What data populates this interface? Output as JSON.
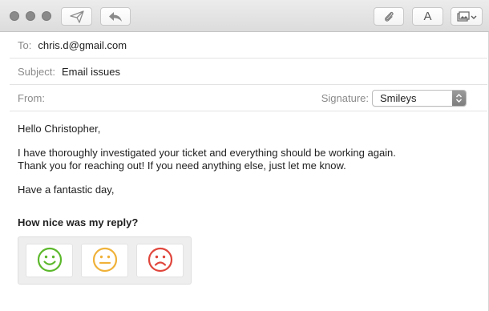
{
  "compose": {
    "to_label": "To:",
    "to_value": "chris.d@gmail.com",
    "subject_label": "Subject:",
    "subject_value": "Email issues",
    "from_label": "From:",
    "signature_label": "Signature:",
    "signature_value": "Smileys"
  },
  "toolbar": {
    "icons": [
      "send-icon",
      "reply-icon",
      "attachment-icon",
      "format-font-icon",
      "photo-browser-icon"
    ],
    "font_glyph": "A"
  },
  "message": {
    "greeting": "Hello Christopher,",
    "line1": "I have thoroughly investigated your ticket and everything should be working again.",
    "line2": "Thank you for reaching out! If you need anything else, just let me know.",
    "closing": "Have a fantastic day,",
    "question": "How nice was my reply?"
  },
  "rating": {
    "options": [
      {
        "name": "happy",
        "color": "#5cb82c"
      },
      {
        "name": "neutral",
        "color": "#f0b23a"
      },
      {
        "name": "sad",
        "color": "#e0463c"
      }
    ]
  }
}
